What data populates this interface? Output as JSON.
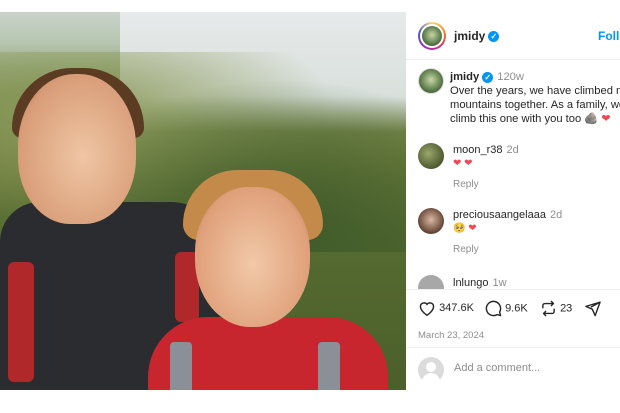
{
  "post": {
    "username": "jmidy",
    "follow_label": "Follo"
  },
  "caption": {
    "username": "jmidy",
    "time": "120w",
    "lines": [
      "Over the years, we have climbed ma",
      "mountains together. As a family, we",
      "climb this one with you too"
    ],
    "emoji": "🪨 ❤"
  },
  "comments": [
    {
      "username": "moon_r38",
      "time": "2d",
      "text": "❤ ❤",
      "reply": "Reply"
    },
    {
      "username": "preciousaangelaaa",
      "time": "2d",
      "text": "🥺 ❤",
      "reply": "Reply"
    },
    {
      "username": "lnlungo",
      "time": "1w"
    }
  ],
  "actions": {
    "likes": "347.6K",
    "comments": "9.6K",
    "reposts": "23",
    "date": "March 23, 2024"
  },
  "add_comment": {
    "placeholder": "Add a comment..."
  },
  "colors": {
    "accent": "#0095f6",
    "heart": "#ed4956"
  }
}
